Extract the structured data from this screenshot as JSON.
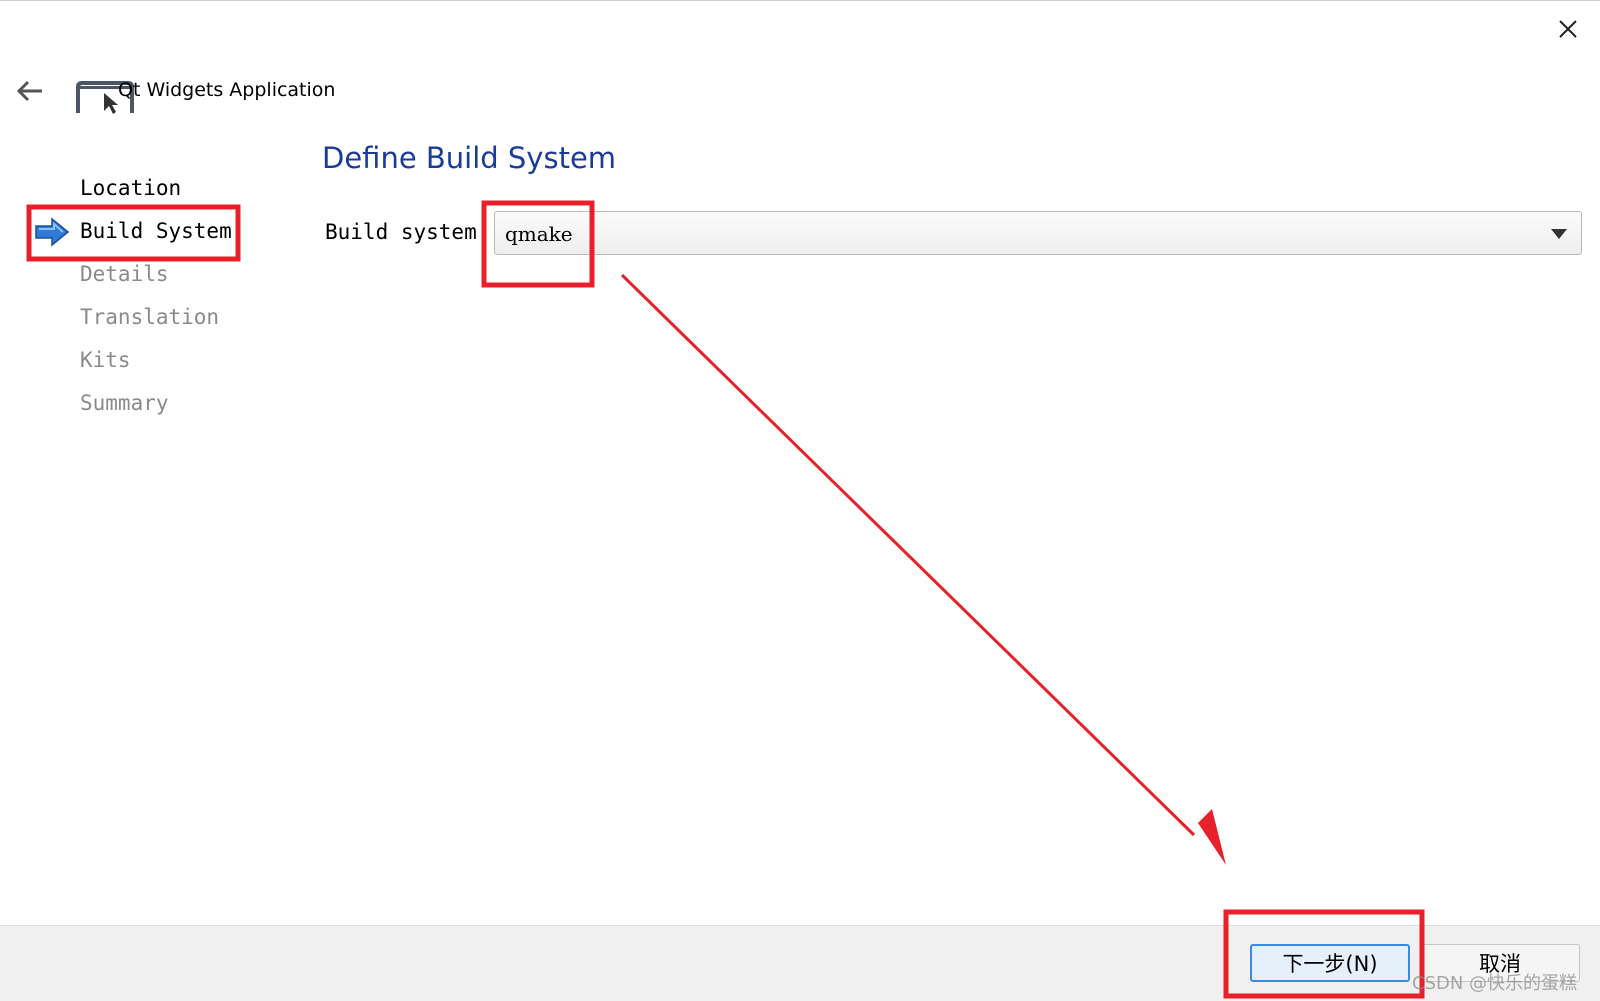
{
  "window": {
    "title": "Qt Widgets Application",
    "close_icon": "close-icon",
    "back_icon": "back-arrow-icon"
  },
  "steps": [
    {
      "label": "Location",
      "state": "done"
    },
    {
      "label": "Build System",
      "state": "current"
    },
    {
      "label": "Details",
      "state": "pending"
    },
    {
      "label": "Translation",
      "state": "pending"
    },
    {
      "label": "Kits",
      "state": "pending"
    },
    {
      "label": "Summary",
      "state": "pending"
    }
  ],
  "page": {
    "title": "Define Build System",
    "build_system_label": "Build system:",
    "build_system_value": "qmake"
  },
  "footer": {
    "next_label": "下一步(N)",
    "cancel_label": "取消"
  },
  "watermark": "CSDN @快乐的蛋糕",
  "colors": {
    "title_blue": "#1a3b9c",
    "annotation_red": "#e8202a",
    "step_arrow_blue": "#2f7ad6",
    "pending_gray": "#8a8a8a"
  }
}
